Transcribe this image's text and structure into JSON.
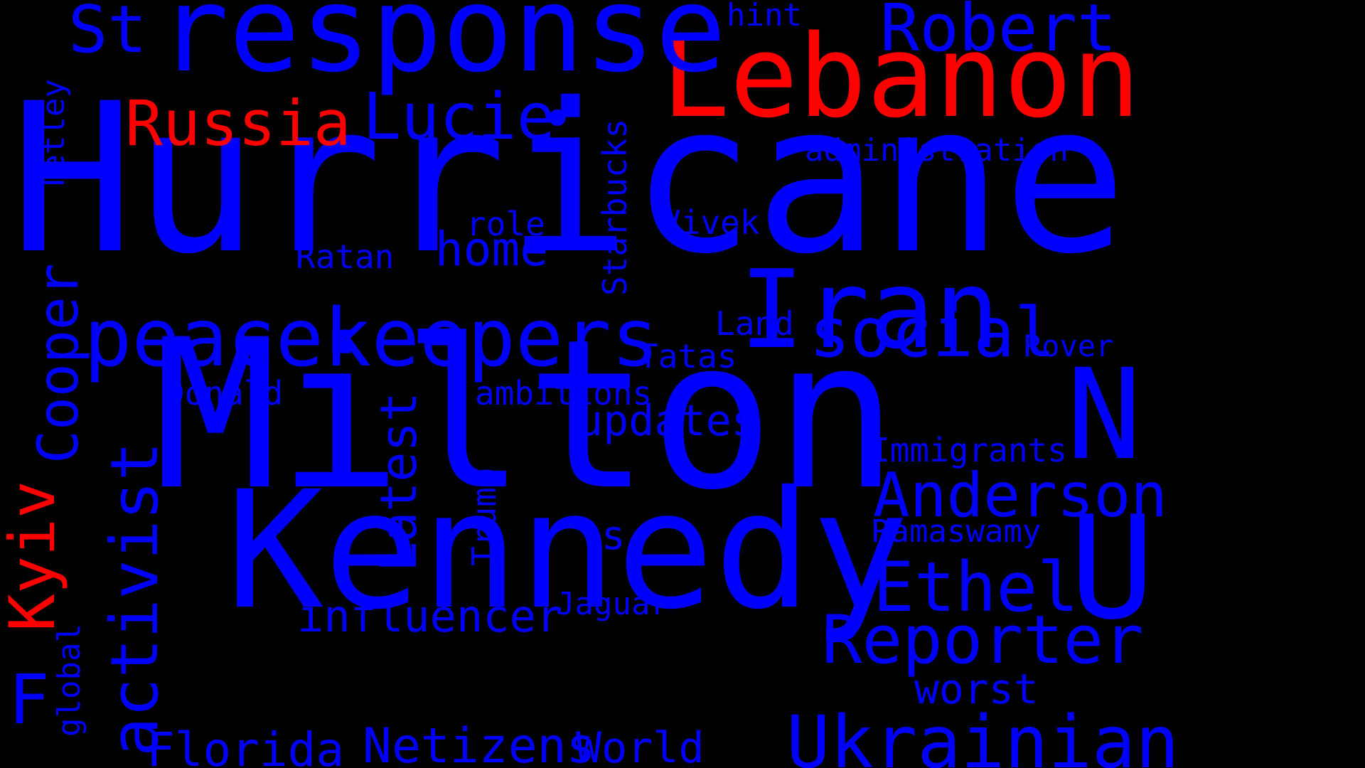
{
  "colors": {
    "background": "#000000",
    "primary": "#0000ff",
    "accent": "#ff0000"
  },
  "words": {
    "hurricane": "Hurricane",
    "milton": "Milton",
    "kennedy": "Kennedy",
    "lebanon": "Lebanon",
    "response": "response",
    "peacekeepers": "peacekeepers",
    "iran": "Iran",
    "russia": "Russia",
    "lucie": "Lucie",
    "robert": "Robert",
    "st": "St",
    "social": "social",
    "ukrainian": "Ukrainian",
    "reporter": "Reporter",
    "anderson": "Anderson",
    "ethel": "Ethel",
    "u": "U",
    "n": "N",
    "florida": "Florida",
    "netizens": "Netizens",
    "world": "World",
    "influencer": "influencer",
    "updates": "updates",
    "home": "home",
    "activist": "activist",
    "cooper": "Cooper",
    "kyiv": "Kyiv",
    "latest": "Latest",
    "starbucks": "Starbucks",
    "trump": "Trump",
    "tetley": "Tetley",
    "global": "global",
    "f": "F",
    "hint": "hint",
    "administration": "administration",
    "role": "role",
    "vivek": "Vivek",
    "ratan": "Ratan",
    "land": "Land",
    "rover": "Rover",
    "tatas": "Tatas",
    "donald": "Donald",
    "ambitions": "ambitions",
    "immigrants": "Immigrants",
    "ramaswamy": "Ramaswamy",
    "s": "s",
    "jaguar": "Jaguar",
    "worst": "worst",
    "dot": "•"
  }
}
